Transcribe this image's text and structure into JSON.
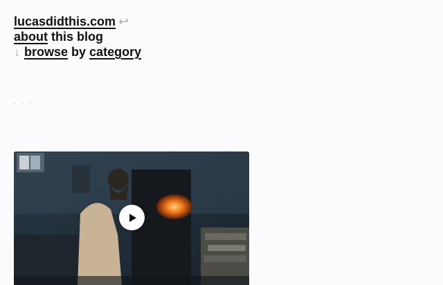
{
  "header": {
    "site_link": "lucasdidthis.com",
    "back_icon": "return-arrow-icon",
    "about_link": "about",
    "about_suffix": " this blog",
    "down_icon": "down-arrow-icon",
    "browse_link": "browse",
    "by_text": " by ",
    "category_link": "category"
  },
  "content": {
    "ellipsis": ". . ."
  },
  "video": {
    "play_icon": "play-icon"
  },
  "colors": {
    "background": "#fbfbfd",
    "text": "#111111",
    "muted_arrow": "#a9a9b3"
  }
}
